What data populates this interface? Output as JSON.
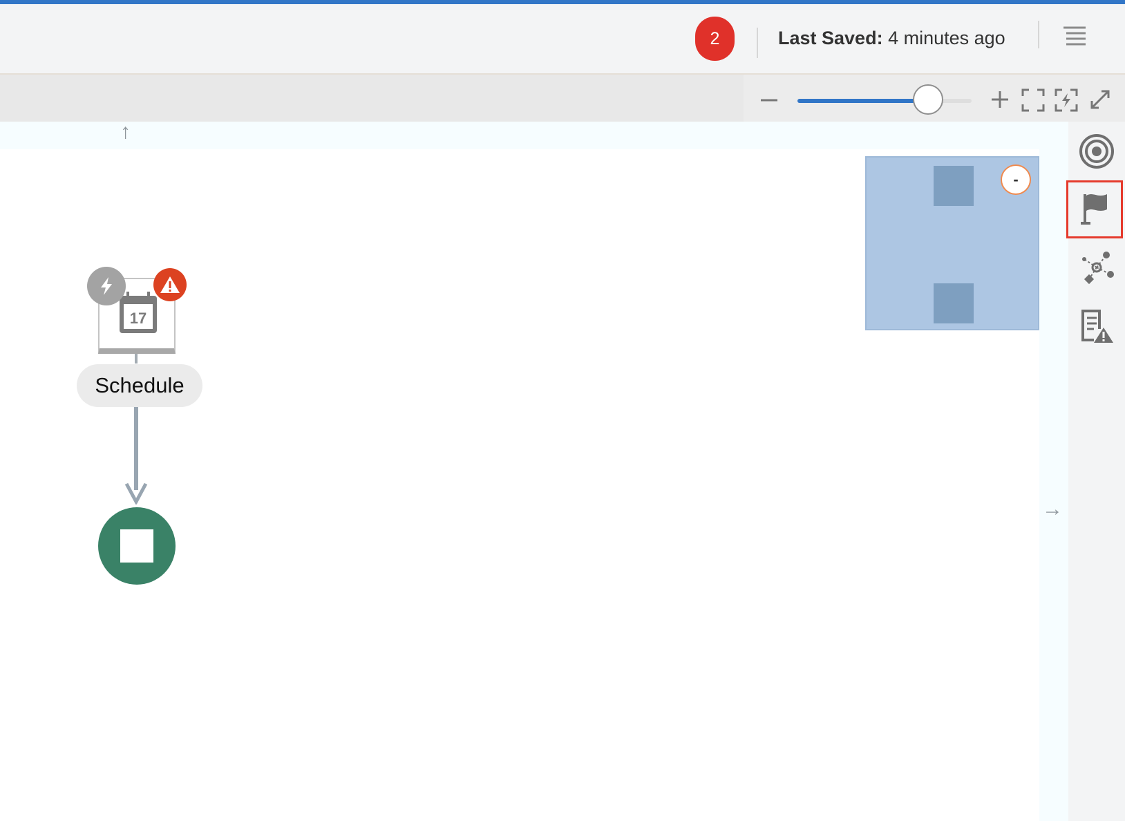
{
  "header": {
    "notification_count": "2",
    "last_saved_label": "Last Saved:",
    "last_saved_value": "4 minutes ago",
    "menu_icon": "hamburger-menu-icon"
  },
  "toolbar": {
    "zoom_out_icon": "minus-icon",
    "zoom_in_icon": "plus-icon",
    "fit_icon": "fit-to-screen-icon",
    "reset_icon": "reset-zoom-icon",
    "fullscreen_icon": "fullscreen-icon",
    "zoom_level": 0.75
  },
  "canvas": {
    "scroll_up_icon": "arrow-up-icon",
    "scroll_right_icon": "arrow-right-icon",
    "trigger_node": {
      "label": "Schedule",
      "calendar_day": "17",
      "trigger_icon": "lightning-icon",
      "warning_icon": "warning-icon"
    },
    "end_node_icon": "stop-icon",
    "minimap": {
      "collapse_label": "-"
    }
  },
  "sidebar": {
    "items": [
      {
        "name": "target-icon",
        "selected": false
      },
      {
        "name": "flag-icon",
        "selected": true
      },
      {
        "name": "network-icon",
        "selected": false
      },
      {
        "name": "document-warning-icon",
        "selected": false
      }
    ]
  },
  "colors": {
    "accent": "#3176c7",
    "badge": "#e0312a",
    "warning": "#dc4221",
    "end_node": "#3a8267",
    "selection": "#e53a2c"
  }
}
